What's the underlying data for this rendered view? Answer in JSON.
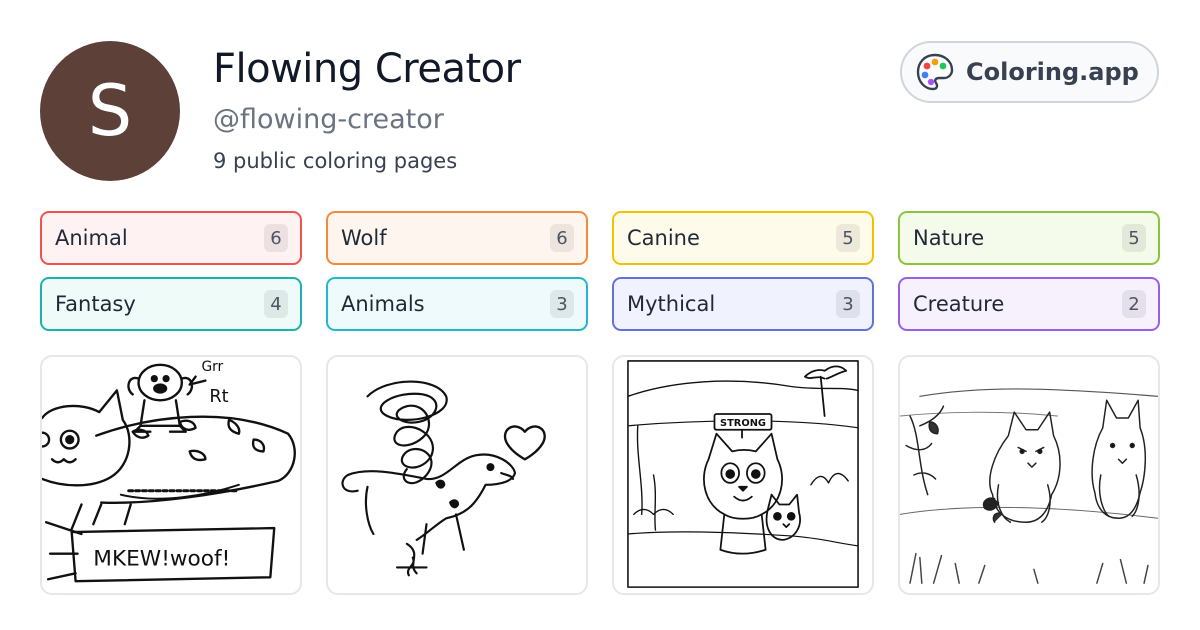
{
  "profile": {
    "avatar_letter": "S",
    "avatar_color": "#5d4037",
    "name": "Flowing Creator",
    "handle": "@flowing-creator",
    "page_count_text": "9 public coloring pages"
  },
  "brand": {
    "label": "Coloring.app",
    "icon": "palette-icon"
  },
  "tags": [
    {
      "label": "Animal",
      "count": "6",
      "border": "#ef5350",
      "bg": "#fef3f2"
    },
    {
      "label": "Wolf",
      "count": "6",
      "border": "#f28a3c",
      "bg": "#fef6ee"
    },
    {
      "label": "Canine",
      "count": "5",
      "border": "#f2c200",
      "bg": "#fefbea"
    },
    {
      "label": "Nature",
      "count": "5",
      "border": "#8bc53f",
      "bg": "#f5fbea"
    },
    {
      "label": "Fantasy",
      "count": "4",
      "border": "#19b3ad",
      "bg": "#eefbf9"
    },
    {
      "label": "Animals",
      "count": "3",
      "border": "#22b8c9",
      "bg": "#eefafc"
    },
    {
      "label": "Mythical",
      "count": "3",
      "border": "#6670d9",
      "bg": "#f0f2fd"
    },
    {
      "label": "Creature",
      "count": "2",
      "border": "#9b5de5",
      "bg": "#f6f1fd"
    }
  ],
  "thumbnails": {
    "one": {
      "sign_text": "MKEW!woof!",
      "label_grr": "Grr",
      "label_rt": "Rt"
    },
    "three": {
      "sign_text": "STRONG"
    }
  }
}
